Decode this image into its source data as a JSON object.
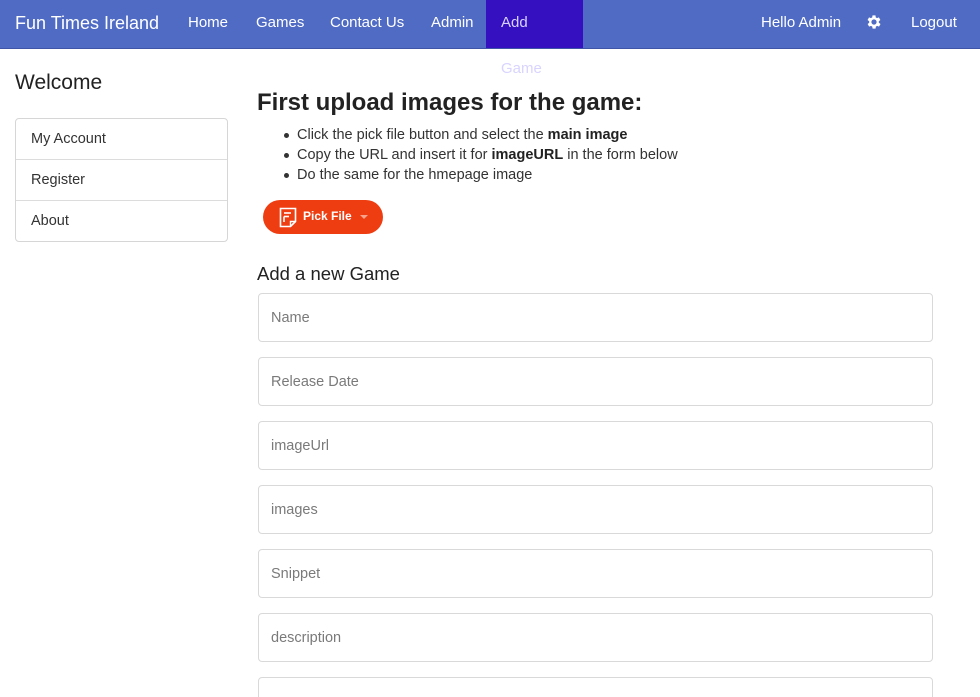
{
  "navbar": {
    "brand": "Fun Times Ireland",
    "items": [
      {
        "label": "Home"
      },
      {
        "label": "Games"
      },
      {
        "label": "Contact Us"
      },
      {
        "label": "Admin"
      },
      {
        "label": "Add Game",
        "active": true
      }
    ],
    "greeting": "Hello Admin",
    "settings_icon": "gear-icon",
    "logout": "Logout",
    "colors": {
      "bar": "#4f6bc4",
      "active": "#3510c0",
      "text": "#ffffff"
    }
  },
  "sidebar": {
    "title": "Welcome",
    "items": [
      {
        "label": "My Account"
      },
      {
        "label": "Register"
      },
      {
        "label": "About"
      }
    ]
  },
  "main": {
    "heading": "First upload images for the game:",
    "instructions": [
      {
        "pre": "Click the pick file button and select the ",
        "bold": "main image",
        "post": ""
      },
      {
        "pre": "Copy the URL and insert it for ",
        "bold": "imageURL",
        "post": " in the form below"
      },
      {
        "pre": "Do the same for the hmepage image",
        "bold": "",
        "post": ""
      }
    ],
    "pick_button": {
      "label": "Pick File",
      "icon": "file-icon",
      "color": "#ef3d12"
    },
    "form_title": "Add a new Game",
    "fields": [
      {
        "placeholder": "Name"
      },
      {
        "placeholder": "Release Date"
      },
      {
        "placeholder": "imageUrl"
      },
      {
        "placeholder": "images"
      },
      {
        "placeholder": "Snippet"
      },
      {
        "placeholder": "description"
      }
    ]
  }
}
